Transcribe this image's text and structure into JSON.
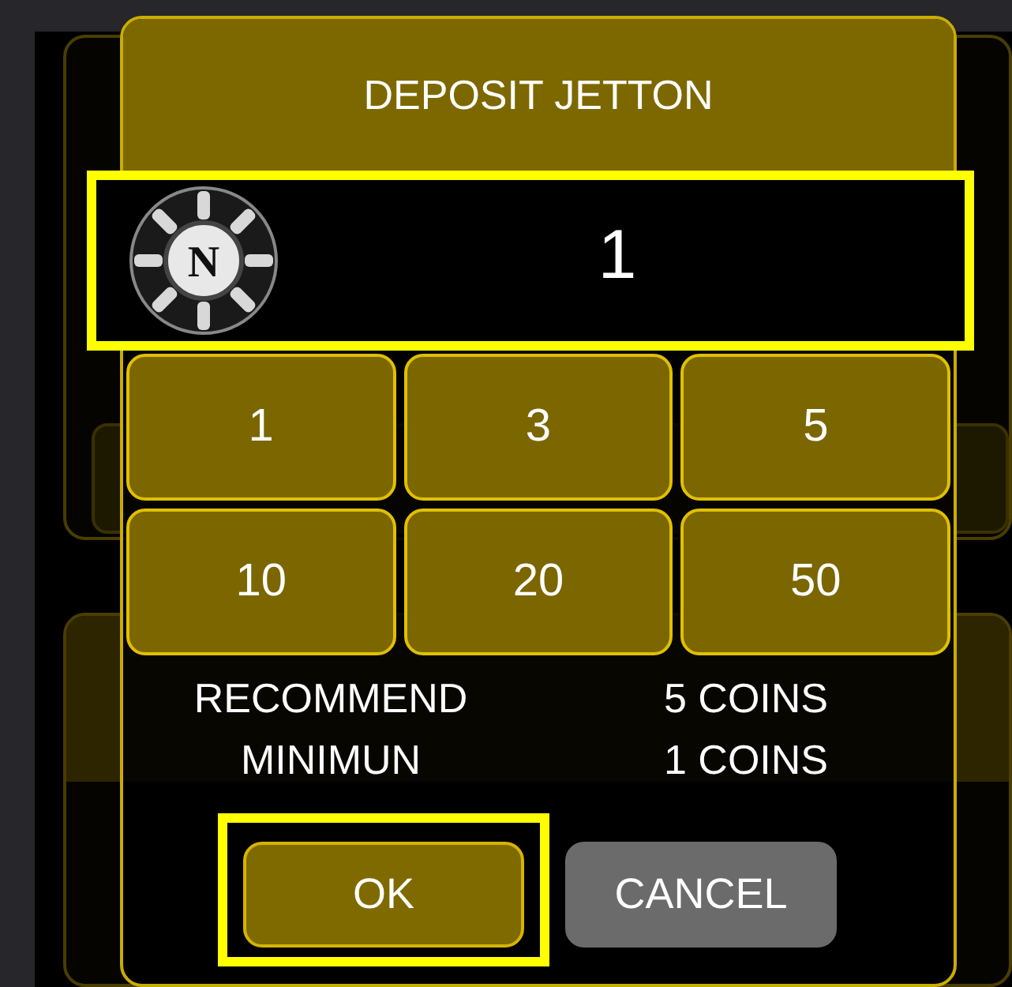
{
  "dialog": {
    "title": "DEPOSIT JETTON",
    "chip_letter": "N",
    "amount": {
      "value": "1",
      "highlighted": true
    },
    "presets": [
      "1",
      "3",
      "5",
      "10",
      "20",
      "50"
    ],
    "info": [
      {
        "label": "RECOMMEND",
        "value": "5 COINS"
      },
      {
        "label": "MINIMUN",
        "value": "1 COINS"
      }
    ],
    "buttons": [
      {
        "label": "OK",
        "kind": "primary",
        "highlighted": true
      },
      {
        "label": "CANCEL",
        "kind": "secondary",
        "highlighted": false
      }
    ]
  }
}
